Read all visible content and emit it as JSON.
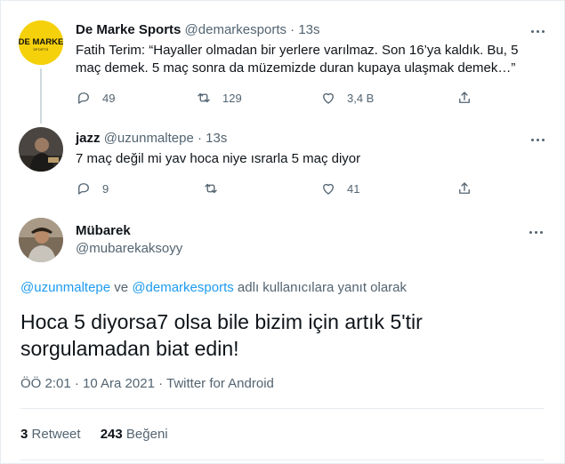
{
  "tweets": [
    {
      "name": "De Marke Sports",
      "handle": "@demarkesports",
      "separator": "·",
      "time": "13s",
      "avatar_text": "DE MARKE",
      "avatar_subtext": "SPORTS",
      "lines": [
        "Fatih Terim: “Hayaller olmadan bir yerlere varılmaz. Son 16’ya kaldık. Bu, 5",
        "maç demek. 5 maç sonra da müzemizde duran kupaya ulaşmak demek…”"
      ],
      "replies": "49",
      "retweets": "129",
      "likes": "3,4 B"
    },
    {
      "name": "jazz",
      "handle": "@uzunmaltepe",
      "separator": "·",
      "time": "13s",
      "lines": [
        "7 maç değil mi yav hoca niye ısrarla 5 maç diyor"
      ],
      "replies": "9",
      "retweets": "",
      "likes": "41"
    }
  ],
  "main_tweet": {
    "name": "Mübarek",
    "handle": "@mubarekaksoyy",
    "reply_to": {
      "user1": "@uzunmaltepe",
      "connector": "ve",
      "user2": "@demarkesports",
      "suffix": "adlı kullanıcılara yanıt olarak"
    },
    "text_lines": [
      "Hoca 5 diyorsa7 olsa bile bizim için artık 5'tir",
      "sorgulamadan biat edin!"
    ],
    "meta": "ÖÖ 2:01 · 10 Ara 2021 · Twitter for Android",
    "retweet_count": "3",
    "retweet_label": "Retweet",
    "like_count": "243",
    "like_label": "Beğeni"
  },
  "colors": {
    "accent": "#1d9bf0",
    "brand_yellow": "#f5d10c",
    "text": "#0f1419",
    "muted": "#536471"
  }
}
